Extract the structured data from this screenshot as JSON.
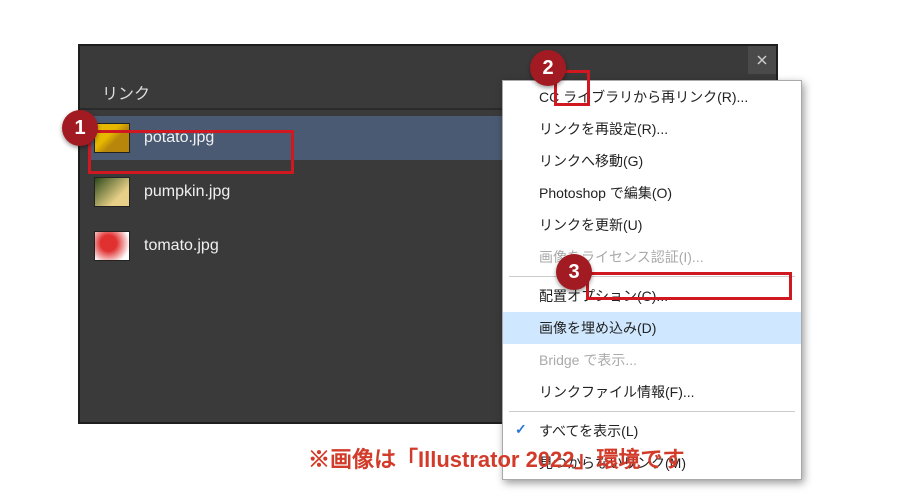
{
  "panel": {
    "tab_label": "リンク",
    "items": [
      {
        "name": "potato.jpg",
        "selected": true
      },
      {
        "name": "pumpkin.jpg",
        "selected": false
      },
      {
        "name": "tomato.jpg",
        "selected": false
      }
    ]
  },
  "menu": {
    "items": [
      {
        "label": "CC ライブラリから再リンク(R)...",
        "enabled": true
      },
      {
        "label": "リンクを再設定(R)...",
        "enabled": true
      },
      {
        "label": "リンクへ移動(G)",
        "enabled": true
      },
      {
        "label": "Photoshop で編集(O)",
        "enabled": true
      },
      {
        "label": "リンクを更新(U)",
        "enabled": true
      },
      {
        "label": "画像をライセンス認証(I)...",
        "enabled": false
      },
      {
        "sep": true
      },
      {
        "label": "配置オプション(C)...",
        "enabled": true
      },
      {
        "label": "画像を埋め込み(D)",
        "enabled": true,
        "highlight": true
      },
      {
        "label": "Bridge で表示...",
        "enabled": false
      },
      {
        "label": "リンクファイル情報(F)...",
        "enabled": true
      },
      {
        "sep": true
      },
      {
        "label": "すべてを表示(L)",
        "enabled": true,
        "checked": true
      },
      {
        "label": "見つからないリンク(M)",
        "enabled": true
      }
    ]
  },
  "callouts": {
    "c1": "1",
    "c2": "2",
    "c3": "3"
  },
  "caption": "※画像は「Illustrator 2022」環境です"
}
